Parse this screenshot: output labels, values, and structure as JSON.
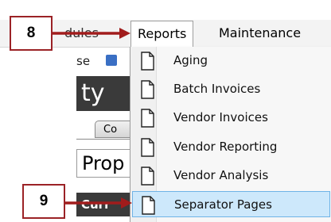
{
  "menubar": {
    "modules_label": "dules",
    "reports_label": "Reports",
    "maintenance_label": "Maintenance"
  },
  "background": {
    "partial_text_1": "se",
    "partial_title": "ty",
    "partial_tab": "Co",
    "partial_prop": "Prop",
    "partial_curr": "Curr"
  },
  "reports_menu": {
    "items": [
      {
        "label": "Aging",
        "icon": "document-icon"
      },
      {
        "label": "Batch Invoices",
        "icon": "document-icon"
      },
      {
        "label": "Vendor Invoices",
        "icon": "document-icon"
      },
      {
        "label": "Vendor Reporting",
        "icon": "document-icon"
      },
      {
        "label": "Vendor Analysis",
        "icon": "document-icon"
      },
      {
        "label": "Separator Pages",
        "icon": "document-icon",
        "selected": true
      }
    ]
  },
  "callouts": {
    "step_8": "8",
    "step_9": "9"
  },
  "colors": {
    "callout_border": "#9b2226",
    "arrow": "#a11c1c",
    "selected_bg": "#cde8fb",
    "selected_border": "#6fb3e6"
  }
}
